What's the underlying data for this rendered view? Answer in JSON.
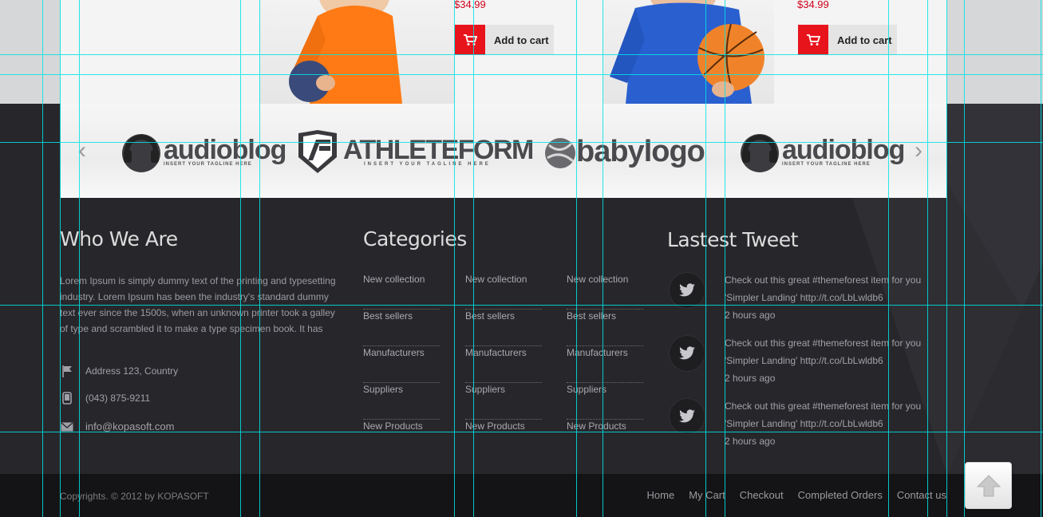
{
  "products": [
    {
      "price": "$34.99",
      "cart_label": "Add to cart"
    },
    {
      "price": "$34.99",
      "cart_label": "Add to cart"
    }
  ],
  "brands": [
    {
      "name": "audioblog",
      "tagline": "INSERT YOUR TAGLINE HERE"
    },
    {
      "name": "ATHLETEFORM",
      "tagline": "INSERT YOUR TAGLINE HERE"
    },
    {
      "name": "babylogo",
      "tagline": ""
    },
    {
      "name": "audioblog",
      "tagline": "INSERT YOUR TAGLINE HERE"
    }
  ],
  "brand_arrows": {
    "prev": "‹",
    "next": "›"
  },
  "who": {
    "title": "Who We Are",
    "text": "Lorem Ipsum is simply dummy text of the printing and typesetting industry. Lorem Ipsum has been the industry's standard dummy text ever since the 1500s, when an unknown printer took a galley of type and scrambled it to make a type specimen book. It has",
    "address": "Address 123, Country",
    "phone": "(043) 875-9211",
    "email": "info@kopasoft.com"
  },
  "categories": {
    "title": "Categories",
    "columns": [
      [
        "New collection",
        "Best sellers",
        "Manufacturers",
        "Suppliers",
        "New Products"
      ],
      [
        "New collection",
        "Best sellers",
        "Manufacturers",
        "Suppliers",
        "New Products"
      ],
      [
        "New collection",
        "Best sellers",
        "Manufacturers",
        "Suppliers",
        "New Products"
      ]
    ]
  },
  "tweets": {
    "title": "Lastest Tweet",
    "items": [
      {
        "text": "Check out this great #themeforest item for you 'Simpler Landing' http://t.co/LbLwldb6",
        "time": "2 hours ago"
      },
      {
        "text": "Check out this great #themeforest item for you 'Simpler Landing' http://t.co/LbLwldb6",
        "time": "2 hours ago"
      },
      {
        "text": "Check out this great #themeforest item for you 'Simpler Landing' http://t.co/LbLwldb6",
        "time": "2 hours ago"
      }
    ]
  },
  "footer": {
    "copyright": "Copyrights. © 2012 by KOPASOFT",
    "nav": [
      "Home",
      "My Cart",
      "Checkout",
      "Completed Orders",
      "Contact us"
    ]
  },
  "colors": {
    "accent": "#e8141c",
    "price": "#d0021b",
    "guide": "#00e5e5",
    "footer_bg": "#27272b"
  }
}
